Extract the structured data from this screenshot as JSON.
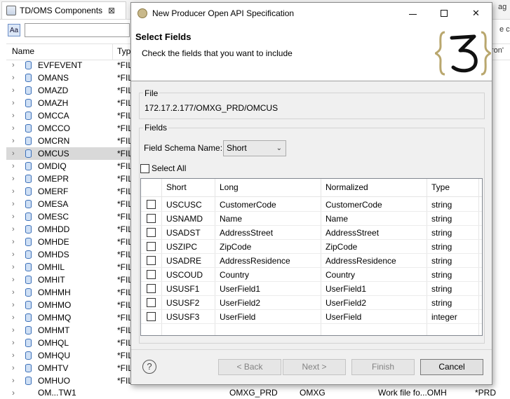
{
  "background": {
    "tab_title": "TD/OMS Components",
    "tab_close": "⊠",
    "filter_icon": "Aa",
    "columns": {
      "name": "Name",
      "type": "Typ"
    },
    "rows": [
      {
        "name": "EVFEVENT",
        "type": "*FIL"
      },
      {
        "name": "OMANS",
        "type": "*FIL"
      },
      {
        "name": "OMAZD",
        "type": "*FIL"
      },
      {
        "name": "OMAZH",
        "type": "*FIL"
      },
      {
        "name": "OMCCA",
        "type": "*FIL"
      },
      {
        "name": "OMCCO",
        "type": "*FIL"
      },
      {
        "name": "OMCRN",
        "type": "*FIL"
      },
      {
        "name": "OMCUS",
        "type": "*FIL"
      },
      {
        "name": "OMDIQ",
        "type": "*FIL"
      },
      {
        "name": "OMEPR",
        "type": "*FIL"
      },
      {
        "name": "OMERF",
        "type": "*FIL"
      },
      {
        "name": "OMESA",
        "type": "*FIL"
      },
      {
        "name": "OMESC",
        "type": "*FIL"
      },
      {
        "name": "OMHDD",
        "type": "*FIL"
      },
      {
        "name": "OMHDE",
        "type": "*FIL"
      },
      {
        "name": "OMHDS",
        "type": "*FIL"
      },
      {
        "name": "OMHIL",
        "type": "*FIL"
      },
      {
        "name": "OMHIT",
        "type": "*FIL"
      },
      {
        "name": "OMHMH",
        "type": "*FIL"
      },
      {
        "name": "OMHMO",
        "type": "*FIL"
      },
      {
        "name": "OMHMQ",
        "type": "*FIL"
      },
      {
        "name": "OMHMT",
        "type": "*FIL"
      },
      {
        "name": "OMHQL",
        "type": "*FIL"
      },
      {
        "name": "OMHQU",
        "type": "*FIL"
      },
      {
        "name": "OMHTV",
        "type": "*FIL"
      },
      {
        "name": "OMHUO",
        "type": "*FIL"
      }
    ],
    "bottom_row": {
      "name": "OM...TW1",
      "col1": "OMXG_PRD",
      "col2": "OMXG",
      "col3": "Work file fo...OMH",
      "col4": "*PRD"
    },
    "right_edge": {
      "tab_fragment": "ag",
      "text1": "e cu",
      "text2": "ron'"
    }
  },
  "dialog": {
    "window_title": "New Producer Open API Specification",
    "heading": "Select Fields",
    "description": "Check the fields that you want to include",
    "file_group_label": "File",
    "file_path": "172.17.2.177/OMXG_PRD/OMCUS",
    "fields_group_label": "Fields",
    "schema_label": "Field Schema Name:",
    "schema_value": "Short",
    "select_all_label": "Select All",
    "table": {
      "columns": [
        "Short",
        "Long",
        "Normalized",
        "Type"
      ],
      "rows": [
        {
          "short": "USCUSC",
          "long": "CustomerCode",
          "normalized": "CustomerCode",
          "type": "string"
        },
        {
          "short": "USNAMD",
          "long": "Name",
          "normalized": "Name",
          "type": "string"
        },
        {
          "short": "USADST",
          "long": "AddressStreet",
          "normalized": "AddressStreet",
          "type": "string"
        },
        {
          "short": "USZIPC",
          "long": "ZipCode",
          "normalized": "ZipCode",
          "type": "string"
        },
        {
          "short": "USADRE",
          "long": "AddressResidence",
          "normalized": "AddressResidence",
          "type": "string"
        },
        {
          "short": "USCOUD",
          "long": "Country",
          "normalized": "Country",
          "type": "string"
        },
        {
          "short": "USUSF1",
          "long": "UserField1",
          "normalized": "UserField1",
          "type": "string"
        },
        {
          "short": "USUSF2",
          "long": "UserField2",
          "normalized": "UserField2",
          "type": "string"
        },
        {
          "short": "USUSF3",
          "long": "UserField",
          "normalized": "UserField",
          "type": "integer"
        }
      ]
    },
    "buttons": {
      "help": "?",
      "back": "< Back",
      "next": "Next >",
      "finish": "Finish",
      "cancel": "Cancel"
    }
  }
}
